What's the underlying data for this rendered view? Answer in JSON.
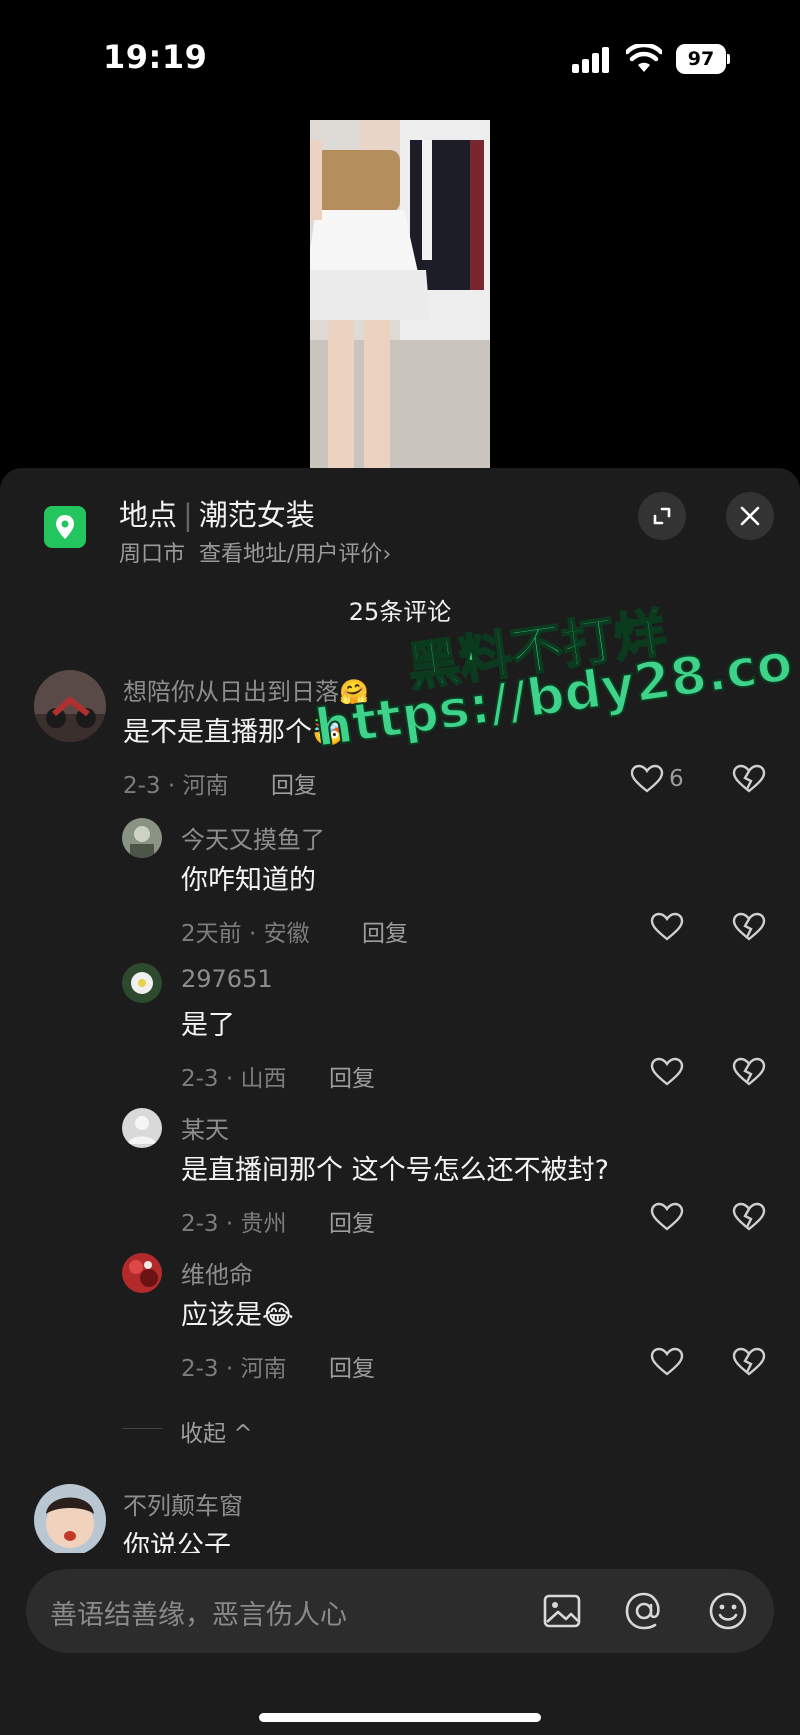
{
  "status": {
    "time": "19:19",
    "battery": "97"
  },
  "location": {
    "label": "地点",
    "name": "潮范女装",
    "city": "周口市",
    "link": "查看地址/用户评价",
    "link_chevron": "›"
  },
  "comments_header": {
    "count_label": "25条评论"
  },
  "comments": [
    {
      "name": "想陪你从日出到日落",
      "name_emoji": "🤗",
      "text": "是不是直播那个",
      "text_emoji": "🤯",
      "meta": "2-3 · 河南",
      "reply": "回复",
      "likes": "6"
    },
    {
      "name": "今天又摸鱼了",
      "text": "你咋知道的",
      "meta": "2天前 · 安徽",
      "reply": "回复"
    },
    {
      "name": "297651",
      "text": "是了",
      "meta": "2-3 · 山西",
      "reply": "回复"
    },
    {
      "name": "某天",
      "text": "是直播间那个 这个号怎么还不被封?",
      "meta": "2-3 · 贵州",
      "reply": "回复"
    },
    {
      "name": "维他命",
      "text": "应该是",
      "text_emoji": "😂",
      "meta": "2-3 · 河南",
      "reply": "回复"
    },
    {
      "name": "不列颠车窗",
      "text": "你说公子"
    }
  ],
  "collapse": {
    "label": "收起",
    "chevron": "^"
  },
  "input": {
    "placeholder": "善语结善缘，恶言伤人心"
  },
  "watermark": {
    "line1": "黑料不打烊",
    "line2": "https://bdy28.co"
  },
  "icons": [
    "location-pin-icon",
    "expand-icon",
    "close-icon",
    "heart-icon",
    "broken-heart-icon",
    "image-icon",
    "at-icon",
    "emoji-icon"
  ],
  "colors": {
    "sheet_bg": "#1c1c1c",
    "location_green": "#22c55e",
    "watermark_green": "#3fd28a"
  }
}
